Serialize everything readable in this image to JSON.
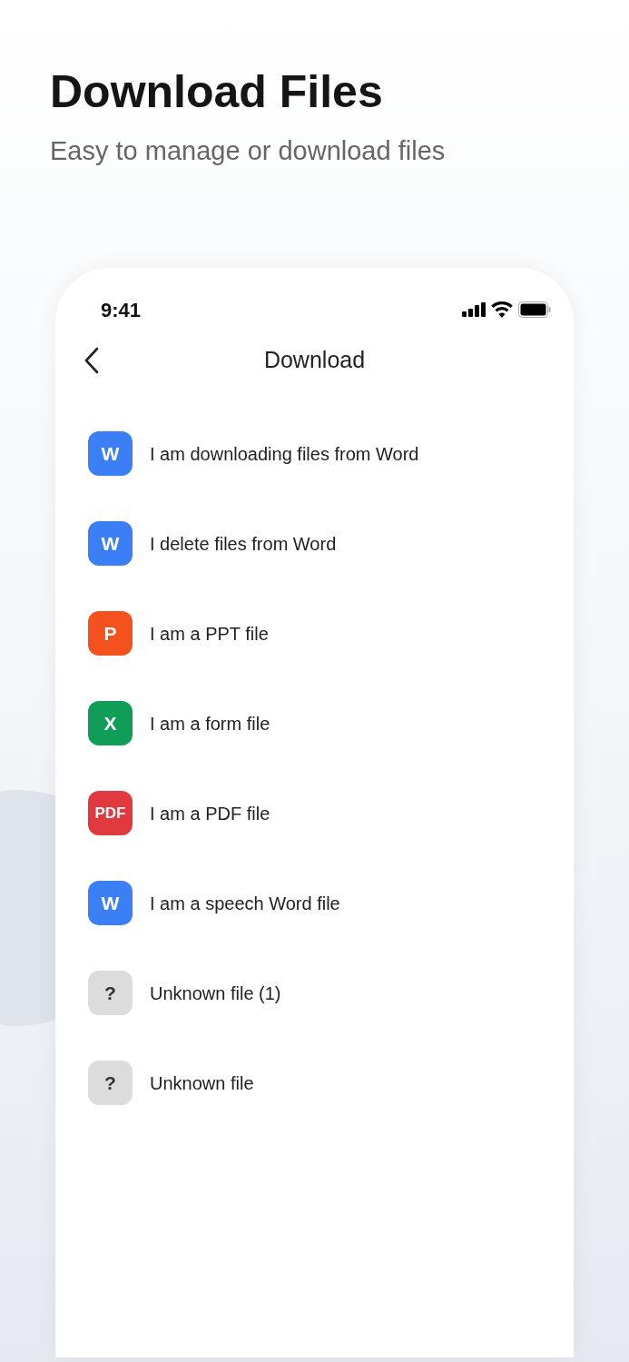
{
  "header": {
    "title": "Download Files",
    "subtitle": "Easy to manage or download files"
  },
  "status_bar": {
    "time": "9:41"
  },
  "nav": {
    "title": "Download"
  },
  "files": [
    {
      "kind": "word",
      "badge": "W",
      "name": "I am downloading files from Word"
    },
    {
      "kind": "word",
      "badge": "W",
      "name": "I delete files from Word"
    },
    {
      "kind": "ppt",
      "badge": "P",
      "name": "I am a PPT file"
    },
    {
      "kind": "excel",
      "badge": "X",
      "name": "I am a form file"
    },
    {
      "kind": "pdf",
      "badge": "PDF",
      "name": "I am a PDF file"
    },
    {
      "kind": "word",
      "badge": "W",
      "name": "I am a speech Word file"
    },
    {
      "kind": "unknown",
      "badge": "?",
      "name": "Unknown file (1)"
    },
    {
      "kind": "unknown",
      "badge": "?",
      "name": "Unknown file"
    }
  ]
}
